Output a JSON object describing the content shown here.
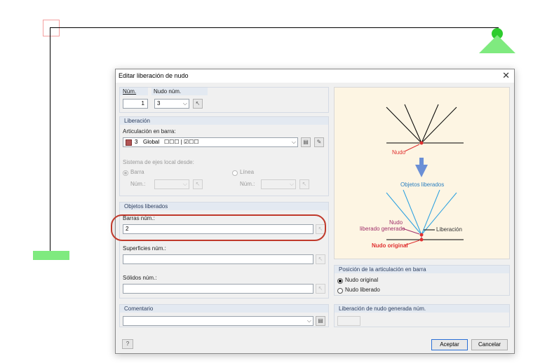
{
  "dialog": {
    "title": "Editar liberación de nudo",
    "close_icon": "close-icon"
  },
  "top": {
    "num_label": "Núm.",
    "num_value": "1",
    "node_label": "Nudo núm.",
    "node_value": "3"
  },
  "liberacion": {
    "header": "Liberación",
    "articulacion_label": "Articulación en barra:",
    "hinge_number": "3",
    "hinge_system": "Global",
    "hinge_pattern": "☐☐☐ | ☑☐☐",
    "axes_label": "Sistema de ejes local desde:",
    "barra_label": "Barra",
    "linea_label": "Línea",
    "num_label_barra": "Núm.:",
    "num_label_linea": "Núm.:"
  },
  "objetos": {
    "header": "Objetos liberados",
    "barras_label": "Barras núm.:",
    "barras_value": "2",
    "superficies_label": "Superficies núm.:",
    "superficies_value": "",
    "solidos_label": "Sólidos núm.:",
    "solidos_value": ""
  },
  "comentario": {
    "header": "Comentario",
    "value": ""
  },
  "diagram": {
    "nudo": "Nudo",
    "objetos_liberados": "Objetos liberados",
    "nudo_liberado_1": "Nudo",
    "nudo_liberado_2": "liberado generado",
    "liberacion": "Liberación",
    "nudo_original": "Nudo original"
  },
  "posicion": {
    "header": "Posición de la articulación en barra",
    "option_original": "Nudo original",
    "option_liberado": "Nudo liberado",
    "selected": "original"
  },
  "generada": {
    "header": "Liberación de nudo generada núm.",
    "value": ""
  },
  "buttons": {
    "aceptar": "Aceptar",
    "cancelar": "Cancelar",
    "help_icon": "help-icon"
  },
  "colors": {
    "support": "#7fea7f",
    "highlight": "#c0392b",
    "diagram_red": "#e03030",
    "diagram_blue": "#2aa0e0",
    "diagram_purple": "#a0306a"
  }
}
